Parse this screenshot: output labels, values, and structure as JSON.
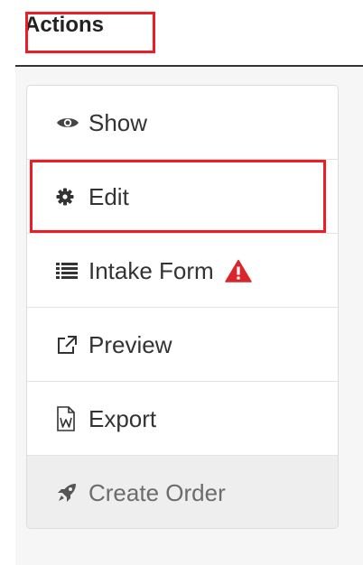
{
  "header": {
    "title": "Actions"
  },
  "menu": {
    "items": [
      {
        "label": "Show",
        "icon": "eye-icon"
      },
      {
        "label": "Edit",
        "icon": "gear-icon"
      },
      {
        "label": "Intake Form",
        "icon": "list-icon",
        "badge_icon": "warning-icon"
      },
      {
        "label": "Preview",
        "icon": "external-link-icon"
      },
      {
        "label": "Export",
        "icon": "word-document-icon"
      },
      {
        "label": "Create Order",
        "icon": "rocket-icon",
        "disabled": true
      }
    ]
  },
  "colors": {
    "highlight": "#ee1c25",
    "warning": "#d9262c",
    "text": "#333333",
    "disabled_bg": "#eeeeee"
  }
}
